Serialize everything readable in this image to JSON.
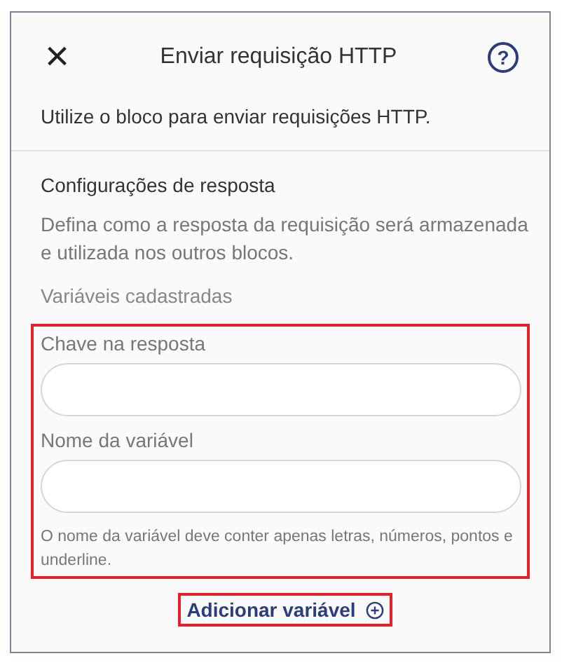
{
  "header": {
    "close": "×",
    "title": "Enviar requisição HTTP",
    "help": "?"
  },
  "intro": "Utilize o bloco para enviar requisições HTTP.",
  "section": {
    "title": "Configurações de resposta",
    "description": "Defina como a resposta da requisição será armazenada e utilizada nos outros blocos.",
    "subtitle": "Variáveis cadastradas"
  },
  "fields": [
    {
      "label": "Chave na resposta"
    },
    {
      "label": "Nome da variável"
    }
  ],
  "hint": "O nome da variável deve conter apenas letras, números, pontos e underline.",
  "add_button": {
    "label": "Adicionar variável"
  }
}
